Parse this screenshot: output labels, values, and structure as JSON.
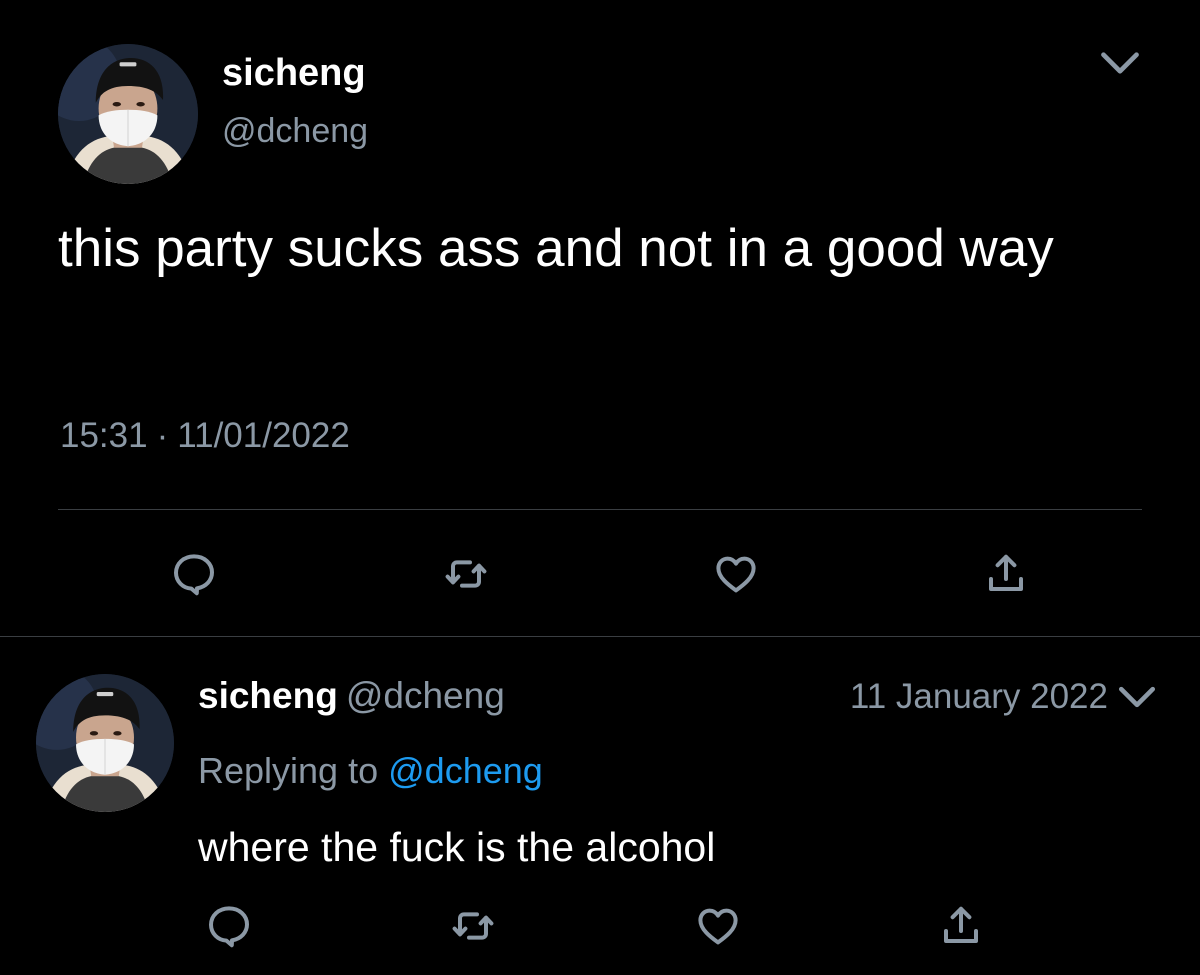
{
  "main_tweet": {
    "display_name": "sicheng",
    "handle": "@dcheng",
    "text": "this party sucks ass and not in a good way",
    "time": "15:31",
    "separator": "·",
    "date": "11/01/2022",
    "avatar_icon": "profile-photo-masked-person"
  },
  "reply_tweet": {
    "display_name": "sicheng",
    "handle": "@dcheng",
    "date": "11 January 2022",
    "replying_to_label": "Replying to",
    "replying_to_handle": "@dcheng",
    "text": "where the fuck is the alcohol",
    "avatar_icon": "profile-photo-masked-person"
  },
  "actions": [
    "reply-icon",
    "retweet-icon",
    "like-icon",
    "share-icon"
  ],
  "colors": {
    "background": "#000000",
    "primary_text": "#ffffff",
    "secondary_text": "#8b98a5",
    "link": "#1d9bf0",
    "divider": "#3a3e42",
    "icon": "#8b98a5"
  }
}
